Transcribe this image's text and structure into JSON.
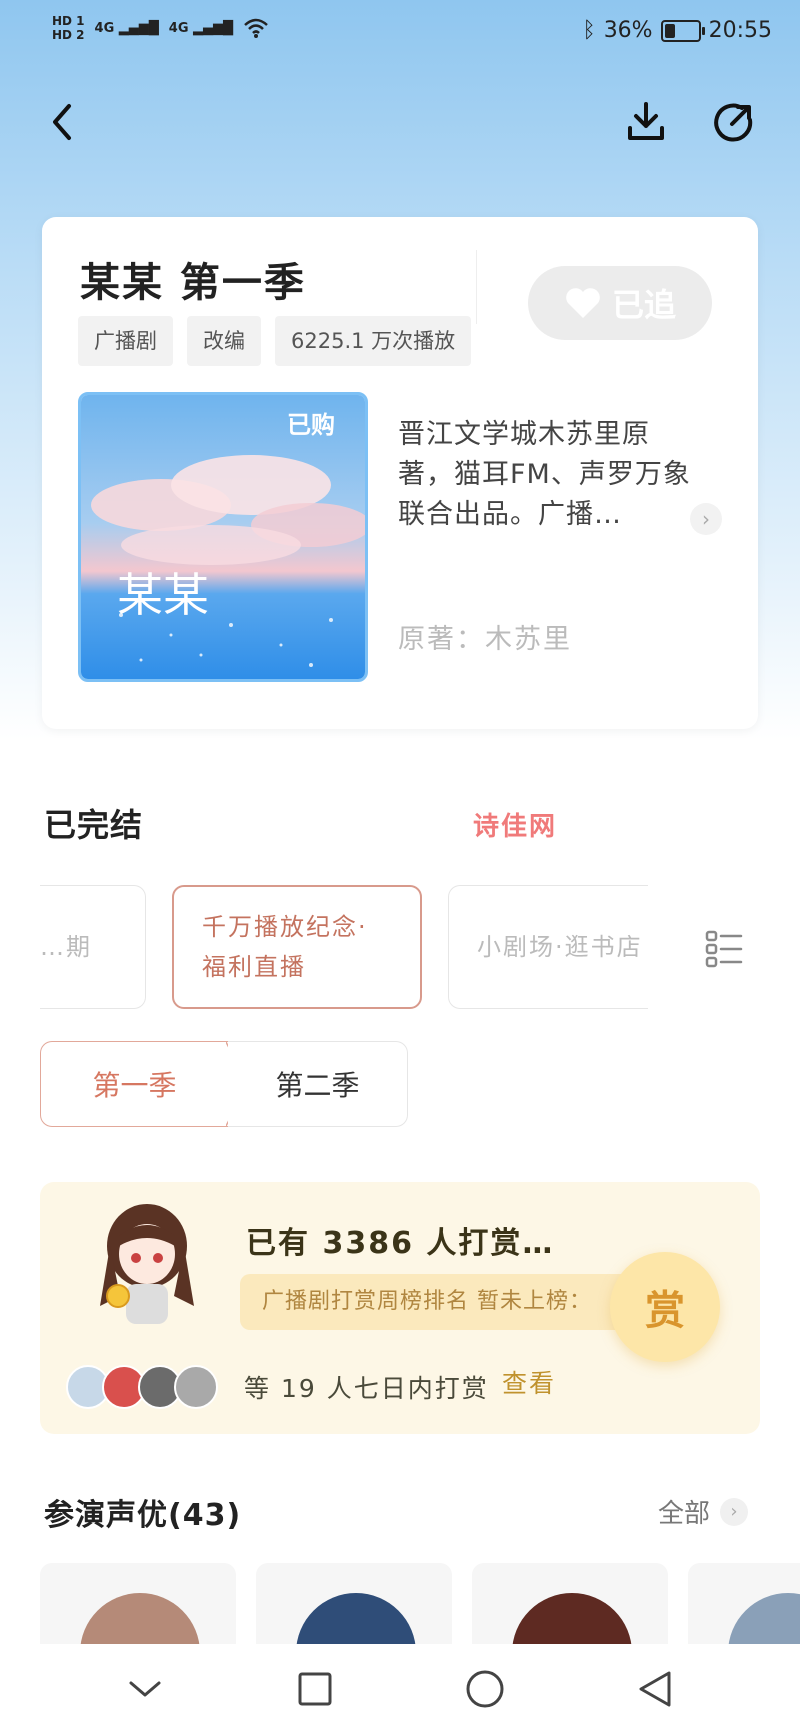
{
  "status_bar": {
    "hd1": "HD 1",
    "hd2": "HD 2",
    "net1": "4G",
    "net2": "4G",
    "battery_text": "36%",
    "battery_level": 0.36,
    "time": "20:55"
  },
  "drama": {
    "title": "某某 第一季",
    "follow_label": "已追",
    "tags": [
      "广播剧",
      "改编",
      "6225.1 万次播放"
    ],
    "cover_badge": "已购",
    "cover_title": "某某",
    "description": "晋江文学城木苏里原著，猫耳FM、声罗万象联合出品。广播…",
    "author": "原著：木苏里"
  },
  "watermark": "诗佳网",
  "episodes": {
    "section_title": "已完结",
    "items": [
      {
        "label": "…期"
      },
      {
        "label": "千万播放纪念·福利直播"
      },
      {
        "label": "小剧场·逛书店"
      }
    ]
  },
  "seasons": [
    "第一季",
    "第二季"
  ],
  "reward": {
    "title": "已有 3386 人打赏…",
    "rank": "广播剧打赏周榜排名 暂未上榜：",
    "button": "赏",
    "summary": "等 19 人七日内打赏",
    "link": "查看"
  },
  "cast": {
    "title": "参演声优(43)",
    "all_label": "全部"
  },
  "icons": {
    "back": "back-arrow-icon",
    "download": "download-icon",
    "share": "share-icon",
    "list_view": "list-view-icon",
    "heart": "heart-icon"
  },
  "colors": {
    "accent": "#d67761",
    "reward_gold": "#d9952d",
    "reward_bg": "#fdf7e6"
  }
}
